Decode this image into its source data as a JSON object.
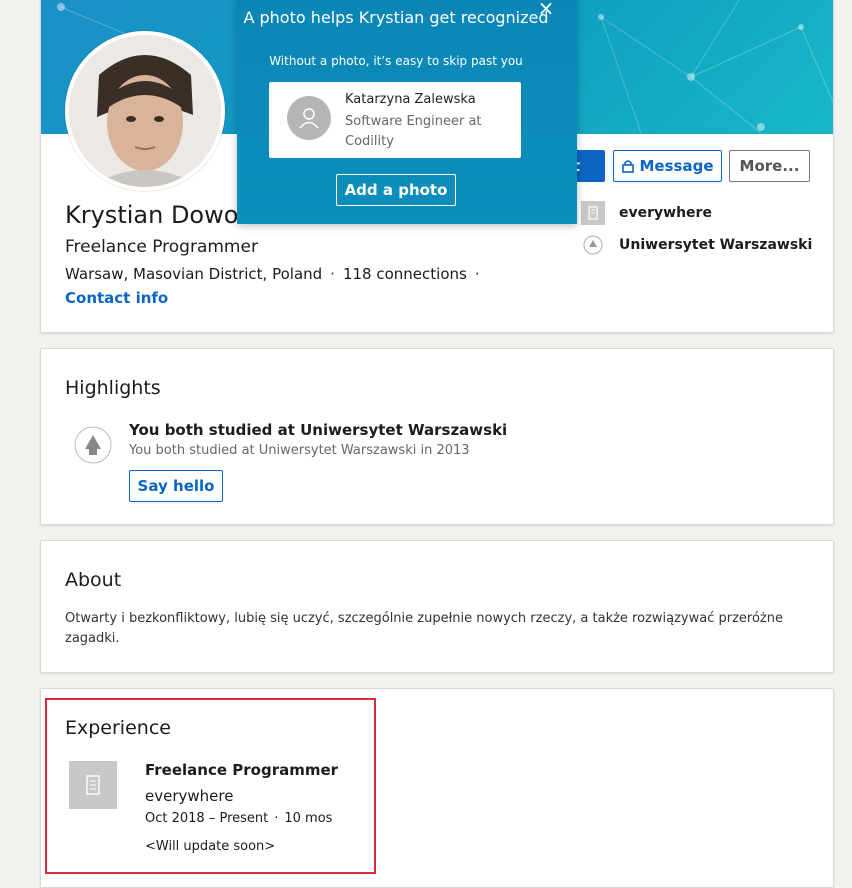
{
  "profile": {
    "name": "Krystian Dowols",
    "headline": "Freelance Programmer",
    "location": "Warsaw, Masovian District, Poland",
    "connections": "118 connections",
    "separator": "·",
    "contact_info": "Contact info",
    "actions": {
      "connect": "ct",
      "message": "Message",
      "more": "More..."
    },
    "side": [
      {
        "label": "everywhere",
        "icon": "building-icon"
      },
      {
        "label": "Uniwersytet Warszawski",
        "icon": "university-logo-icon"
      }
    ]
  },
  "photo_prompt": {
    "title": "A photo helps Krystian get recognized",
    "subtitle": "Without a photo, it’s easy to skip past you",
    "close": "×",
    "example_name": "Katarzyna Zalewska",
    "example_role": "Software Engineer at Codility",
    "add_photo": "Add a photo"
  },
  "highlights": {
    "title": "Highlights",
    "item_title": "You both studied at Uniwersytet Warszawski",
    "item_sub": "You both studied at Uniwersytet Warszawski in 2013",
    "say_hello": "Say hello"
  },
  "about": {
    "title": "About",
    "text": "Otwarty i bezkonfliktowy, lubię się uczyć, szczególnie zupełnie nowych rzeczy, a także rozwiązywać przeróżne zagadki."
  },
  "experience": {
    "title": "Experience",
    "job_title": "Freelance Programmer",
    "company": "everywhere",
    "dates": "Oct 2018 – Present",
    "separator": "·",
    "duration": "10 mos",
    "description": "<Will update soon>"
  },
  "colors": {
    "accent": "#0a66c2",
    "banner": "#0f9ec1",
    "highlight_border": "#d62b3c"
  }
}
